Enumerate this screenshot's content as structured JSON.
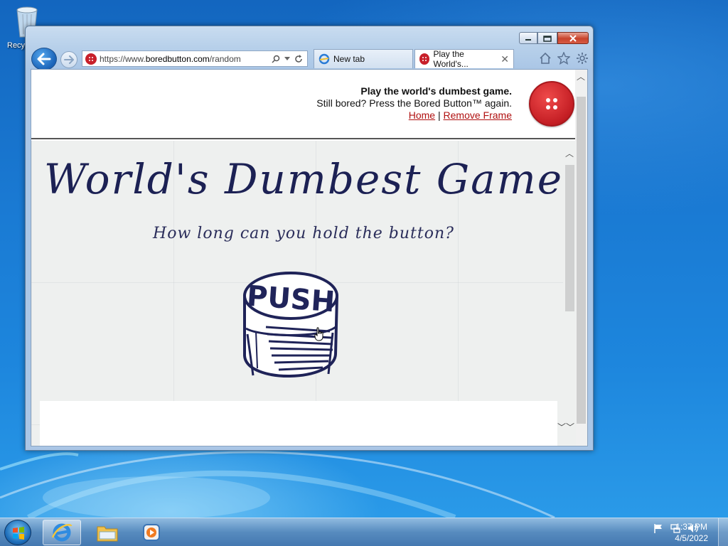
{
  "desktop": {
    "recycle_bin_label": "Recy"
  },
  "browser": {
    "address_url_prefix": "https://www.",
    "address_url_host": "boredbutton.com",
    "address_url_path": "/random",
    "tabs": [
      {
        "label": "New tab",
        "active": false
      },
      {
        "label": "Play the World's...",
        "active": true
      }
    ],
    "toolbar_icons": [
      "home-icon",
      "star-icon",
      "gear-icon"
    ]
  },
  "page": {
    "header_title": "Play the world's dumbest game.",
    "header_subtitle": "Still bored? Press the Bored Button™ again.",
    "link_home": "Home",
    "link_separator": "|",
    "link_remove_frame": "Remove Frame",
    "game_title": "World's Dumbest Game",
    "game_subtitle": "How long can you hold the button?",
    "push_label": "PUSH"
  },
  "colors": {
    "accent_red": "#c41e24",
    "ink": "#1c2154"
  },
  "taskbar": {
    "items": [
      "start-button",
      "internet-explorer",
      "file-explorer",
      "media-player"
    ],
    "clock_time": "1:37 PM",
    "clock_date": "4/5/2022"
  }
}
